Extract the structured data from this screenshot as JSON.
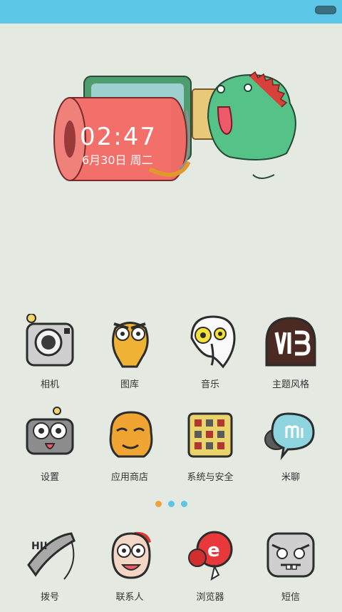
{
  "clock": {
    "time": "02:47",
    "date": "6月30日 周二"
  },
  "apps_row1": [
    {
      "label": "相机",
      "icon": "camera-icon"
    },
    {
      "label": "图库",
      "icon": "gallery-icon"
    },
    {
      "label": "音乐",
      "icon": "music-icon"
    },
    {
      "label": "主题风格",
      "icon": "themes-icon"
    }
  ],
  "apps_row2": [
    {
      "label": "设置",
      "icon": "settings-icon"
    },
    {
      "label": "应用商店",
      "icon": "app-store-icon"
    },
    {
      "label": "系统与安全",
      "icon": "security-icon"
    },
    {
      "label": "米聊",
      "icon": "miliao-icon"
    }
  ],
  "dock": [
    {
      "label": "拨号",
      "icon": "phone-icon"
    },
    {
      "label": "联系人",
      "icon": "contacts-icon"
    },
    {
      "label": "浏览器",
      "icon": "browser-icon"
    },
    {
      "label": "短信",
      "icon": "messages-icon"
    }
  ],
  "page_indicator": {
    "pages": 3,
    "current": 1
  },
  "colors": {
    "status_bar": "#5bc6e6",
    "background": "#e4e9e1",
    "dot_active": "#f2a23a",
    "dot_inactive": "#5bc6e6"
  }
}
